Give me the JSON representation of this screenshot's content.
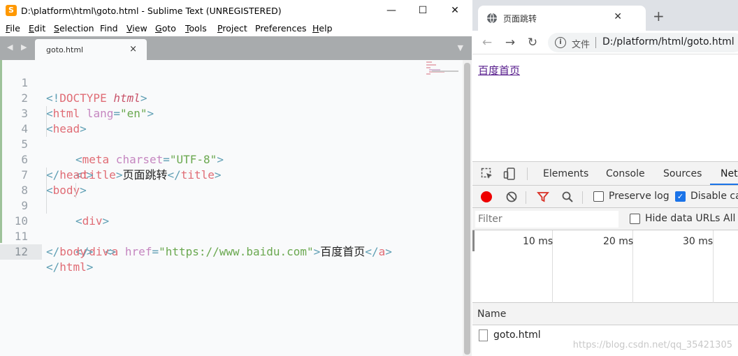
{
  "sublime": {
    "app_icon_glyph": "S",
    "title": "D:\\platform\\html\\goto.html - Sublime Text (UNREGISTERED)",
    "window_buttons": {
      "minimize": "—",
      "maximize": "☐",
      "close": "✕"
    },
    "menu": [
      {
        "underline": "F",
        "rest": "ile"
      },
      {
        "underline": "E",
        "rest": "dit"
      },
      {
        "underline": "S",
        "rest": "election"
      },
      {
        "underline": "F",
        "rest": "ind",
        "prefix": "F",
        "full": "Find"
      },
      {
        "underline": "V",
        "rest": "iew"
      },
      {
        "underline": "G",
        "rest": "oto"
      },
      {
        "underline": "T",
        "rest": "ools"
      },
      {
        "underline": "P",
        "rest": "roject"
      },
      {
        "underline": "P",
        "rest": "references",
        "full": "Preferences"
      },
      {
        "underline": "H",
        "rest": "elp"
      }
    ],
    "nav_arrows": "◀ ▶",
    "tab": {
      "label": "goto.html",
      "close": "×"
    },
    "tab_dropdown": "▼",
    "current_line": 12,
    "line_numbers": [
      "1",
      "2",
      "3",
      "4",
      "5",
      "6",
      "7",
      "8",
      "9",
      "10",
      "11",
      "12"
    ],
    "code_text": {
      "l1_open": "<!",
      "l1_doctype": "DOCTYPE ",
      "l1_html": "html",
      "l1_close": ">",
      "l2_open": "<",
      "l2_tag": "html",
      "l2_attr": " lang",
      "l2_eq": "=",
      "l2_val": "\"en\"",
      "l2_close": ">",
      "l3_open": "<",
      "l3_tag": "head",
      "l3_close": ">",
      "l4_open": "<",
      "l4_tag": "meta",
      "l4_attr": " charset",
      "l4_eq": "=",
      "l4_val": "\"UTF-8\"",
      "l4_close": ">",
      "l5_open": "<",
      "l5_tag": "title",
      "l5_close": ">",
      "l5_text": "页面跳转",
      "l5_end_open": "</",
      "l5_end_tag": "title",
      "l5_end_close": ">",
      "l6_open": "</",
      "l6_tag": "head",
      "l6_close": ">",
      "l7_open": "<",
      "l7_tag": "body",
      "l7_close": ">",
      "l8_open": "<",
      "l8_tag": "div",
      "l8_close": ">",
      "l9_open": "<",
      "l9_tag": "a",
      "l9_attr": " href",
      "l9_eq": "=",
      "l9_val": "\"https://www.baidu.com\"",
      "l9_close": ">",
      "l9_text": "百度首页",
      "l9_end_open": "</",
      "l9_end_tag": "a",
      "l9_end_close": ">",
      "l10_open": "</",
      "l10_tag": "div",
      "l10_close": ">",
      "l11_open": "</",
      "l11_tag": "body",
      "l11_close": ">",
      "l12_open": "</",
      "l12_tag": "html",
      "l12_close": ">"
    }
  },
  "chrome": {
    "tab": {
      "title": "页面跳转",
      "close": "✕",
      "icon": "globe-icon"
    },
    "new_tab": "+",
    "nav": {
      "back": "←",
      "forward": "→",
      "reload": "↻"
    },
    "omnibox": {
      "info": "i",
      "scheme_label": "文件",
      "url": "D:/platform/html/goto.html"
    },
    "page": {
      "link_text": "百度首页"
    },
    "devtools": {
      "tabs": [
        "Elements",
        "Console",
        "Sources",
        "Netw"
      ],
      "active_tab": "Netw",
      "toolbar": {
        "preserve_log_label": "Preserve log",
        "preserve_log_checked": false,
        "disable_cache_label": "Disable ca",
        "disable_cache_checked": true
      },
      "filter": {
        "placeholder": "Filter",
        "hide_data_urls_label": "Hide data URLs",
        "hide_data_urls_checked": false,
        "all_label": "All"
      },
      "timeline_ticks": [
        "10 ms",
        "20 ms",
        "30 ms"
      ],
      "name_header": "Name",
      "requests": [
        "goto.html"
      ]
    }
  },
  "watermark": "https://blog.csdn.net/qq_35421305",
  "colors": {
    "tag": "#e06c75",
    "punctuation": "#5f9fb4",
    "attribute": "#c586c0",
    "string": "#6aa84f",
    "visited_link": "#551a8b",
    "record": "#ee0000",
    "devtools_accent": "#1a73e8"
  }
}
